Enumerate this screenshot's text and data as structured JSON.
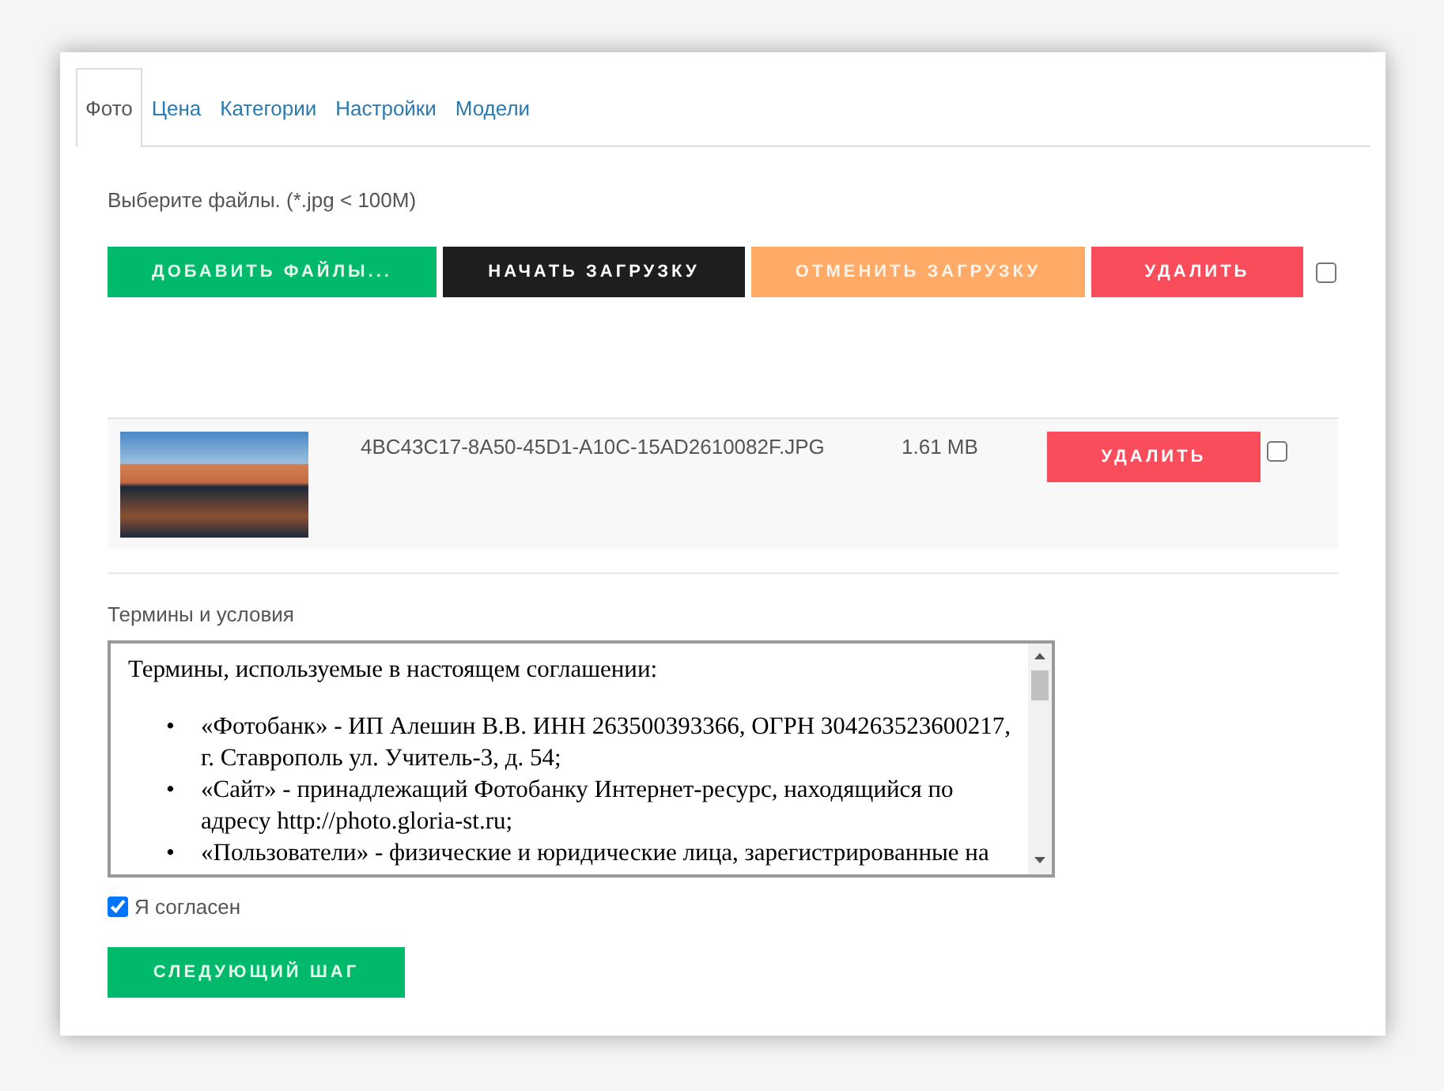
{
  "tabs": [
    {
      "label": "Фото",
      "selected": true
    },
    {
      "label": "Цена",
      "selected": false
    },
    {
      "label": "Категории",
      "selected": false
    },
    {
      "label": "Настройки",
      "selected": false
    },
    {
      "label": "Модели",
      "selected": false
    }
  ],
  "upload_hint": "Выберите файлы. (*.jpg < 100M)",
  "toolbar_buttons": [
    {
      "label": "ДОБАВИТЬ ФАЙЛЫ...",
      "kind": "add"
    },
    {
      "label": "НАЧАТЬ ЗАГРУЗКУ",
      "kind": "start"
    },
    {
      "label": "ОТМЕНИТЬ ЗАГРУЗКУ",
      "kind": "cancel"
    },
    {
      "label": "УДАЛИТЬ",
      "kind": "delete"
    }
  ],
  "select_all": {
    "checked": false
  },
  "files": [
    {
      "filename": "4BC43C17-8A50-45D1-A10C-15AD2610082F.JPG",
      "size": "1.61 MB",
      "delete_label": "УДАЛИТЬ",
      "checked": false
    }
  ],
  "terms": {
    "label": "Термины и условия",
    "intro": "Термины, используемые в настоящем соглашении:",
    "items": [
      {
        "marker": "•",
        "text": "«Фотобанк» - ИП Алешин В.В. ИНН 263500393366, ОГРН 304263523600217, г. Ставрополь ул. Учитель-3, д. 54;"
      },
      {
        "marker": "•",
        "text": "«Сайт» - принадлежащий Фотобанку Интернет-ресурс, находящийся по адресу http://photo.gloria-st.ru;"
      },
      {
        "marker": "•",
        "text": "«Пользователи» - физические и юридические лица, зарегистрированные на"
      }
    ]
  },
  "agree": {
    "label": "Я согласен",
    "checked": true
  },
  "next_button": "СЛЕДУЮЩИЙ ШАГ"
}
